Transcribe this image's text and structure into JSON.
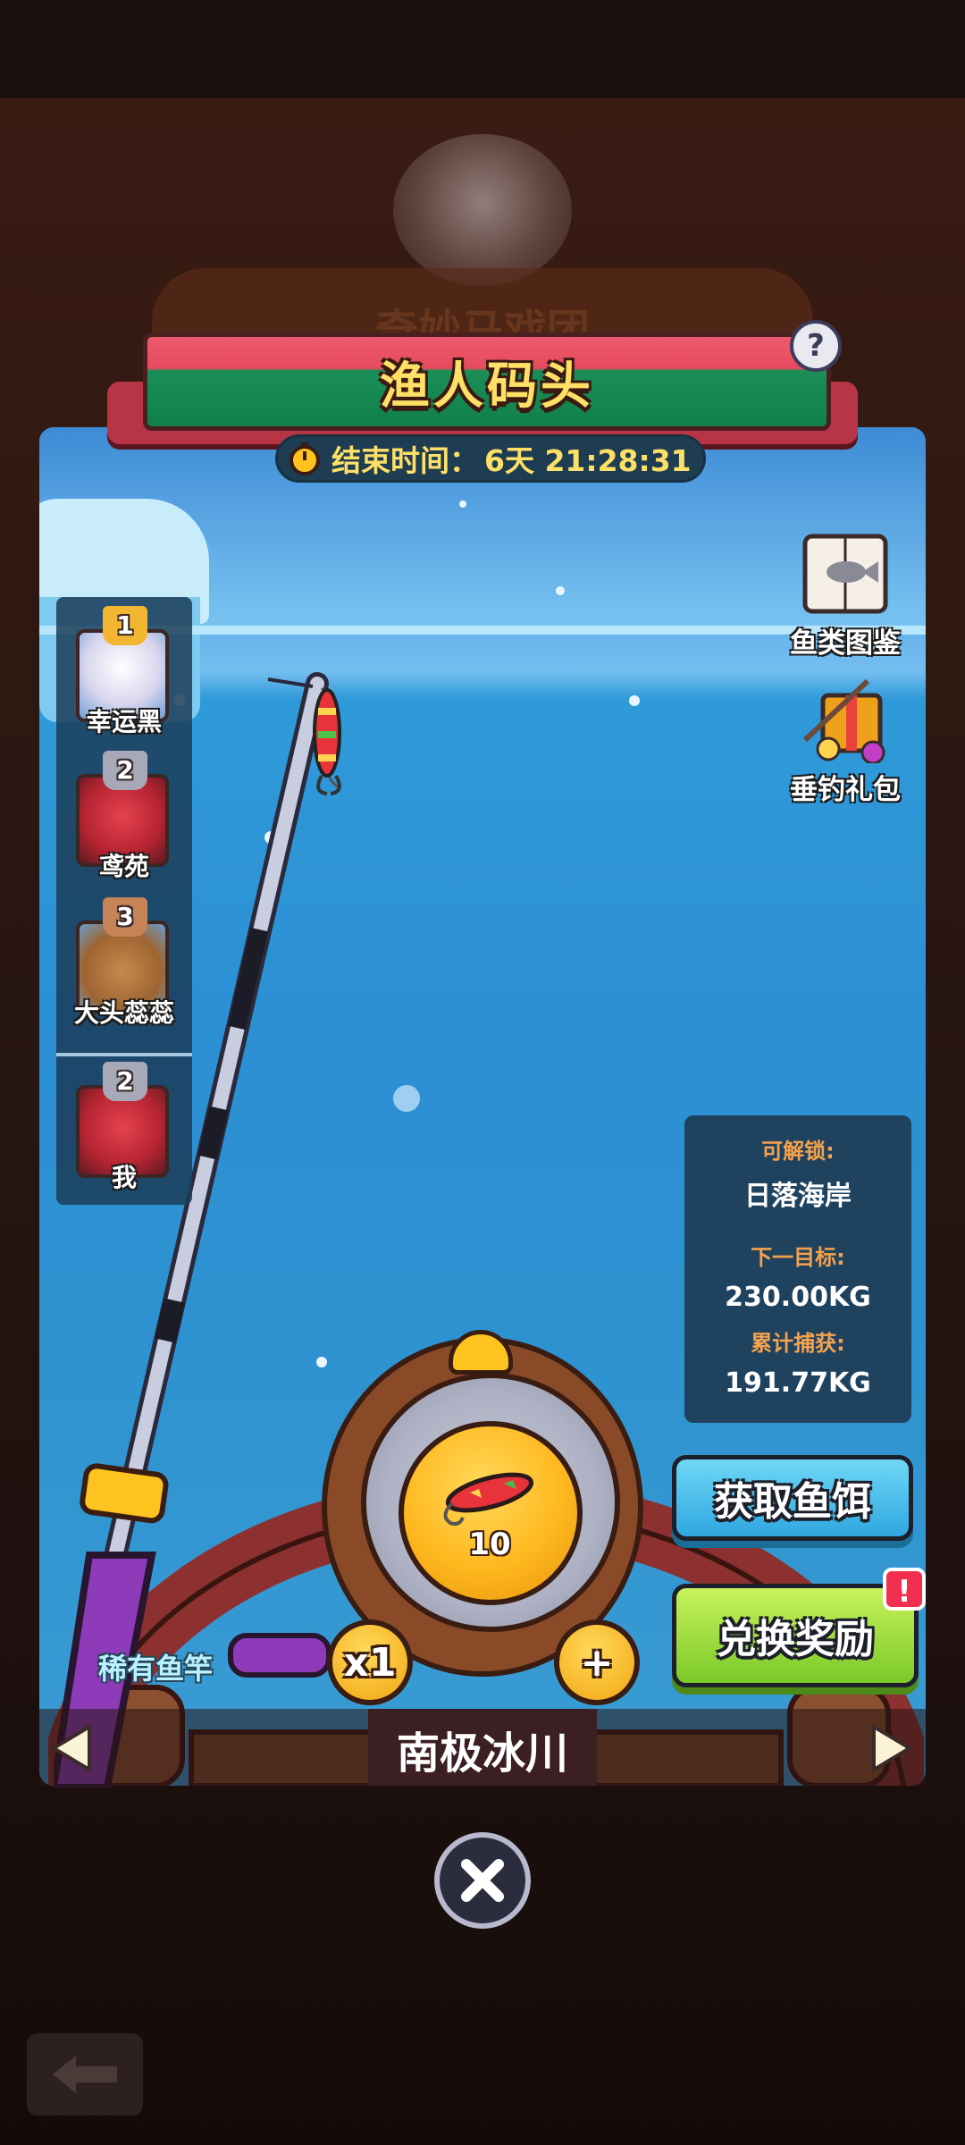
{
  "background": {
    "bg_title": "奇妙马戏团"
  },
  "header": {
    "title": "渔人码头",
    "help_label": "?"
  },
  "timer": {
    "label": "结束时间：",
    "value": "6天 21:28:31"
  },
  "ranking": [
    {
      "rank": "1",
      "name": "幸运黑",
      "avatar": "white-hair-girl-avatar",
      "badge_color": "#f2b631"
    },
    {
      "rank": "2",
      "name": "鸢苑",
      "avatar": "red-dragon-avatar",
      "badge_color": "#a7a9b8"
    },
    {
      "rank": "3",
      "name": "大头蕊蕊",
      "avatar": "capybara-avatar",
      "badge_color": "#c58356"
    }
  ],
  "me": {
    "rank": "2",
    "name": "我",
    "avatar": "red-dragon-avatar",
    "badge_color": "#a7a9b8"
  },
  "side_buttons": {
    "fish_guide": "鱼类图鉴",
    "fishing_pack": "垂钓礼包"
  },
  "unlock_info": {
    "unlock_label": "可解锁:",
    "unlock_value": "日落海岸",
    "next_target_label": "下一目标:",
    "next_target_value": "230.00KG",
    "total_caught_label": "累计捕获:",
    "total_caught_value": "191.77KG"
  },
  "reel": {
    "bait_count": "10",
    "multiplier": "x1",
    "plus_label": "+"
  },
  "actions": {
    "get_bait": "获取鱼饵",
    "exchange_reward": "兑换奖励",
    "reward_alert": "!"
  },
  "rod": {
    "label": "稀有鱼竿"
  },
  "location": {
    "name": "南极冰川"
  },
  "colors": {
    "accent_yellow": "#ffe066",
    "info_label": "#f5a24d",
    "bait_button": "#2fa7e0",
    "reward_button": "#7cc92a"
  }
}
